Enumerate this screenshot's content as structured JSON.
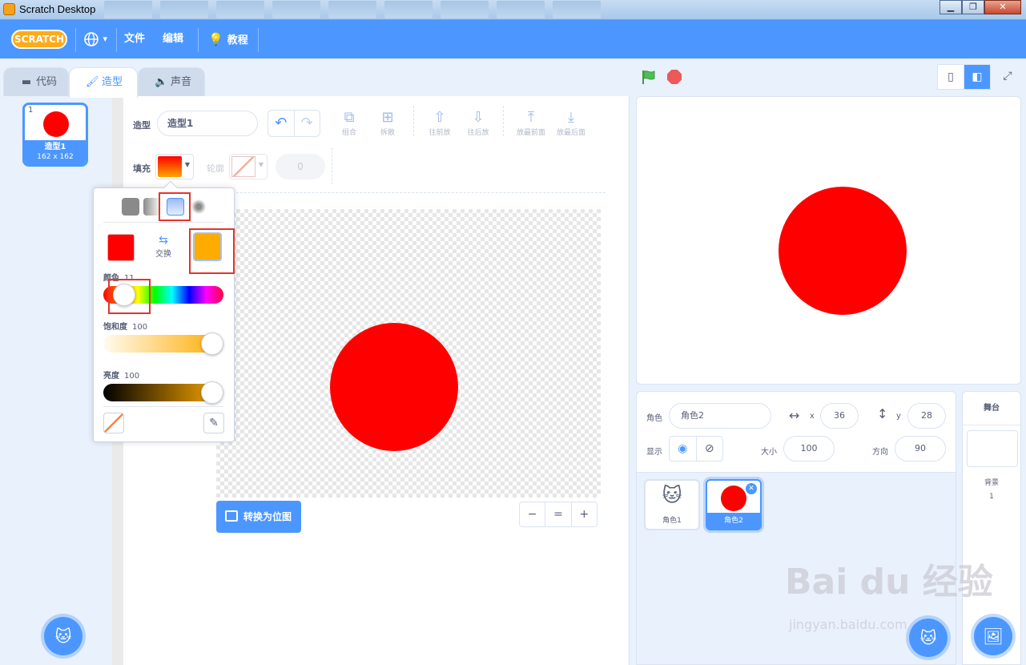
{
  "window": {
    "title": "Scratch Desktop",
    "min": "▁",
    "max": "❐",
    "close": "✕"
  },
  "menubar": {
    "logo": "SCRATCH",
    "globe_caret": "▾",
    "file": "文件",
    "edit": "编辑",
    "tutorials": "教程"
  },
  "tabs": [
    {
      "label": "代码",
      "icon": "blocks-icon"
    },
    {
      "label": "造型",
      "icon": "brush-icon"
    },
    {
      "label": "声音",
      "icon": "speaker-icon"
    }
  ],
  "costumes": [
    {
      "number": "1",
      "name": "造型1",
      "size": "162 x 162"
    }
  ],
  "editor": {
    "costume_label": "造型",
    "costume_name": "造型1",
    "fill_label": "填充",
    "outline_label": "轮廓",
    "outline_width": "0",
    "convert_button": "转换为位图",
    "tools": [
      "组合",
      "拆散",
      "往前放",
      "往后放",
      "放最前面",
      "放最后面"
    ],
    "zoom": {
      "out": "−",
      "reset": "=",
      "in": "+"
    }
  },
  "color_picker": {
    "swap_label": "交换",
    "color_a": "#ff0000",
    "color_b": "#ffab00",
    "sliders": [
      {
        "label": "颜色",
        "value": "11"
      },
      {
        "label": "饱和度",
        "value": "100"
      },
      {
        "label": "亮度",
        "value": "100"
      }
    ]
  },
  "sprite_info": {
    "sprite_label": "角色",
    "sprite_name": "角色2",
    "x_label": "x",
    "x_value": "36",
    "y_label": "y",
    "y_value": "28",
    "show_label": "显示",
    "size_label": "大小",
    "size_value": "100",
    "direction_label": "方向",
    "direction_value": "90"
  },
  "sprites": [
    {
      "name": "角色1"
    },
    {
      "name": "角色2",
      "selected": true
    }
  ],
  "stage_pane": {
    "title": "舞台",
    "backdrops_label": "背景",
    "backdrops_count": "1"
  },
  "watermark": {
    "logo": "Bai du 经验",
    "url": "jingyan.baidu.com"
  },
  "colors": {
    "accent": "#4c97ff",
    "menubar": "#4c97ff",
    "shape_fill": "#ff0000"
  }
}
